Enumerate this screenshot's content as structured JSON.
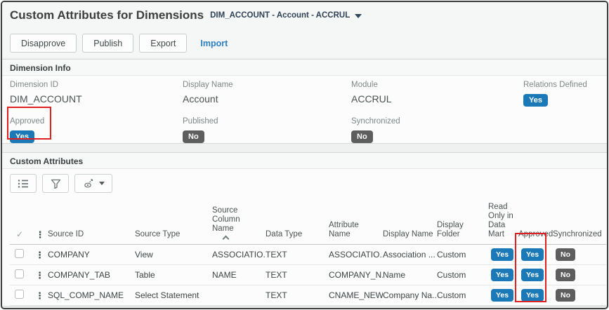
{
  "header": {
    "title": "Custom Attributes for Dimensions",
    "context_selector": "DIM_ACCOUNT - Account - ACCRUL",
    "buttons": {
      "disapprove": "Disapprove",
      "publish": "Publish",
      "export": "Export",
      "import": "Import"
    }
  },
  "dimension_info": {
    "section_title": "Dimension Info",
    "fields": {
      "dimension_id": {
        "label": "Dimension ID",
        "value": "DIM_ACCOUNT"
      },
      "display_name": {
        "label": "Display Name",
        "value": "Account"
      },
      "module": {
        "label": "Module",
        "value": "ACCRUL"
      },
      "relations_defined": {
        "label": "Relations Defined",
        "value": "Yes"
      },
      "approved": {
        "label": "Approved",
        "value": "Yes"
      },
      "published": {
        "label": "Published",
        "value": "No"
      },
      "synchronized": {
        "label": "Synchronized",
        "value": "No"
      }
    }
  },
  "custom_attributes": {
    "section_title": "Custom Attributes",
    "columns": {
      "source_id": "Source ID",
      "source_type": "Source Type",
      "source_column_name": "Source Column\nName",
      "data_type": "Data Type",
      "attribute_name": "Attribute Name",
      "display_name": "Display Name",
      "display_folder": "Display Folder",
      "read_only_in_data_mart": "Read Only in Data Mart",
      "approved": "Approved",
      "synchronized": "Synchronized"
    },
    "sort": {
      "column": "Source Column Name",
      "direction": "ascending"
    },
    "rows": [
      {
        "source_id": "COMPANY",
        "source_type": "View",
        "source_column_name": "ASSOCIATIO...",
        "data_type": "TEXT",
        "attribute_name": "ASSOCIATIO...",
        "display_name": "Association ...",
        "display_folder": "Custom",
        "read_only": "Yes",
        "approved": "Yes",
        "synchronized": "No"
      },
      {
        "source_id": "COMPANY_TAB",
        "source_type": "Table",
        "source_column_name": "NAME",
        "data_type": "TEXT",
        "attribute_name": "COMPANY_N...",
        "display_name": "Name",
        "display_folder": "Custom",
        "read_only": "Yes",
        "approved": "Yes",
        "synchronized": "No"
      },
      {
        "source_id": "SQL_COMP_NAME",
        "source_type": "Select Statement",
        "source_column_name": "",
        "data_type": "TEXT",
        "attribute_name": "CNAME_NEW",
        "display_name": "Company Na...",
        "display_folder": "Custom",
        "read_only": "Yes",
        "approved": "Yes",
        "synchronized": "No"
      }
    ],
    "toolbar_icons": [
      "choose-columns-icon",
      "filter-icon",
      "export-view-icon",
      "dropdown-caret-icon"
    ]
  },
  "annotations": {
    "highlighted_field": "Approved",
    "highlighted_column": "Approved"
  },
  "colors": {
    "accent_blue": "#1b79b8",
    "badge_gray": "#5e5e5e",
    "highlight_red": "#e02020",
    "link_blue": "#2b80c4"
  }
}
